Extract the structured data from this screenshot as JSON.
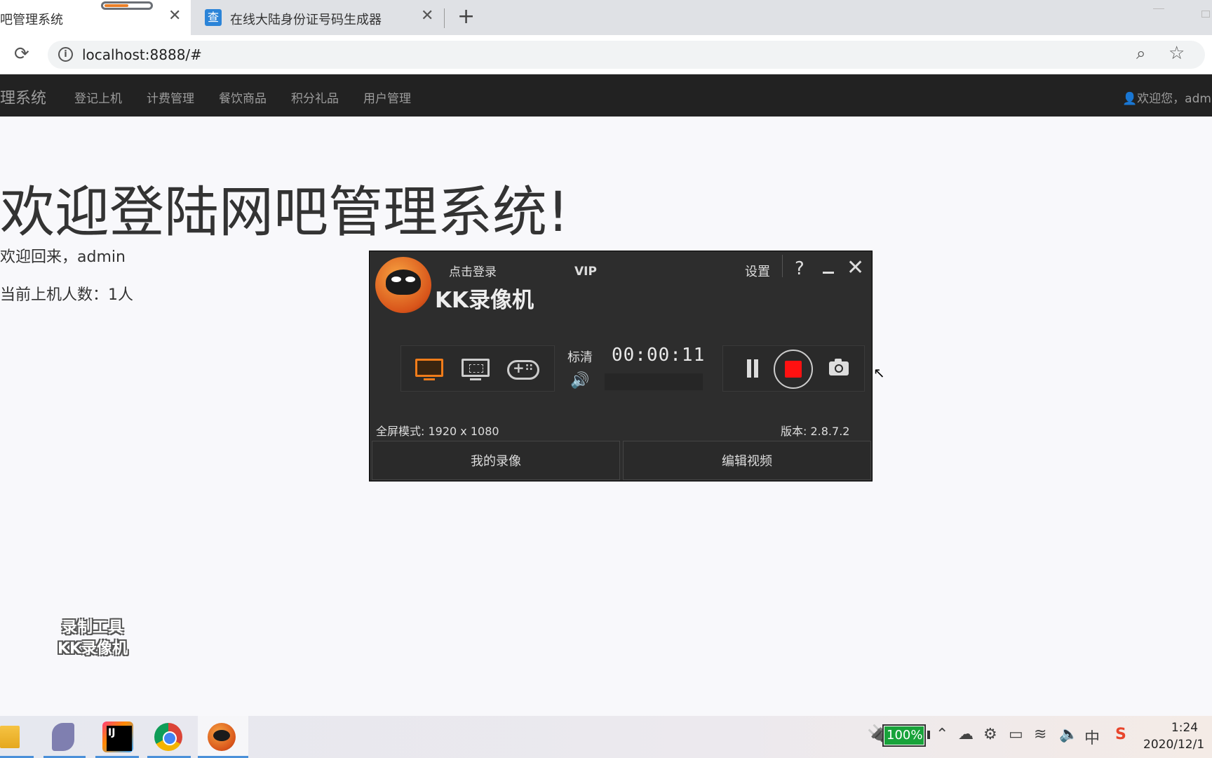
{
  "browser": {
    "active_tab": {
      "title": "吧管理系统",
      "close_icon": "✕"
    },
    "inactive_tab": {
      "favicon_text": "查",
      "title": "在线大陆身份证号码生成器",
      "close_icon": "✕"
    },
    "new_tab_icon": "+",
    "url": "localhost:8888/#"
  },
  "navbar": {
    "brand": "理系统",
    "items": [
      {
        "label": "登记上机"
      },
      {
        "label": "计费管理"
      },
      {
        "label": "餐饮商品"
      },
      {
        "label": "积分礼品"
      },
      {
        "label": "用户管理"
      }
    ],
    "user_greeting": "欢迎您，admi"
  },
  "content": {
    "headline": "欢迎登陆网吧管理系统!",
    "welcome_line": "欢迎回来，admin",
    "online_line": "当前上机人数：1人"
  },
  "watermark": {
    "line1": "录制工具",
    "line2": "KK录像机"
  },
  "recorder": {
    "login_label": "点击登录",
    "vip_label": "VIP",
    "title": "KK录像机",
    "settings_label": "设置",
    "help_label": "?",
    "close_label": "✕",
    "quality": "标清",
    "timer": "00:00:11",
    "mode_info": "全屏模式: 1920 x 1080",
    "version": "版本: 2.8.7.2",
    "my_videos_button": "我的录像",
    "edit_video_button": "编辑视频",
    "accent_color": "#f07c1a",
    "stop_color": "#ff1111"
  },
  "taskbar": {
    "battery_percent": "100%",
    "battery_level": 1.0,
    "tray_ime": "中",
    "tray_sogou": "S",
    "time": "1:24",
    "date": "2020/12/1"
  }
}
